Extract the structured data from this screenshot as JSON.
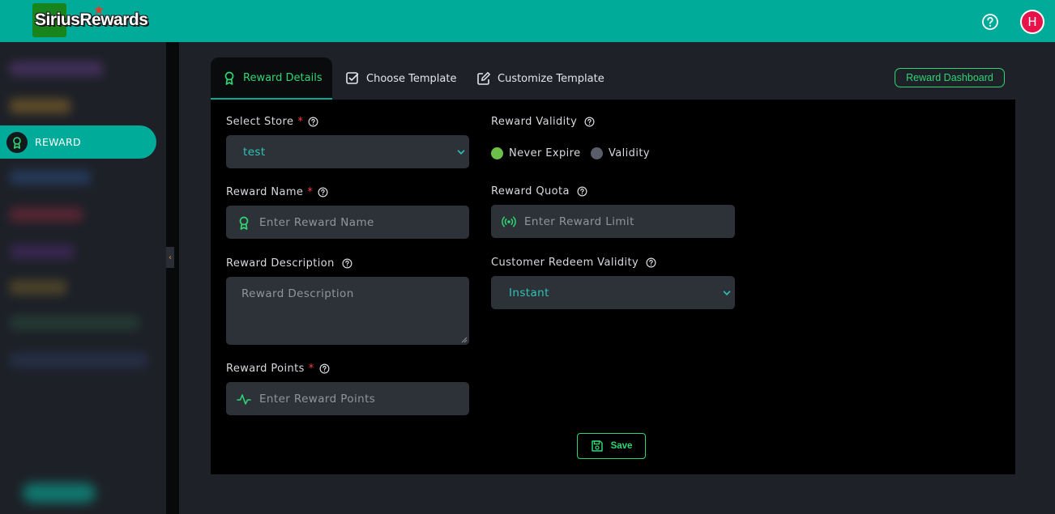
{
  "header": {
    "logo_text": "SiriusRewards",
    "avatar_initial": "H",
    "colors": {
      "bar": "#00ab9a",
      "avatar": "#e8124a"
    }
  },
  "sidebar": {
    "active_item": {
      "label": "REWARD",
      "icon": "award-icon"
    }
  },
  "tabs": [
    {
      "label": "Reward Details",
      "icon": "award-icon",
      "active": true
    },
    {
      "label": "Choose Template",
      "icon": "checkbox-icon",
      "active": false
    },
    {
      "label": "Customize Template",
      "icon": "edit-icon",
      "active": false
    }
  ],
  "dashboard_button": "Reward Dashboard",
  "form": {
    "select_store": {
      "label": "Select Store",
      "value": "test"
    },
    "reward_name": {
      "label": "Reward Name",
      "placeholder": "Enter Reward  Name"
    },
    "reward_description": {
      "label": "Reward Description",
      "placeholder": "Reward  Description"
    },
    "reward_points": {
      "label": "Reward Points",
      "placeholder": "Enter Reward  Points"
    },
    "reward_validity": {
      "label": "Reward Validity",
      "options": [
        {
          "label": "Never Expire",
          "selected": true
        },
        {
          "label": "Validity",
          "selected": false
        }
      ]
    },
    "reward_quota": {
      "label": "Reward Quota",
      "placeholder": "Enter Reward Limit"
    },
    "customer_redeem_validity": {
      "label": "Customer Redeem Validity",
      "value": "Instant"
    },
    "required_mark": "*"
  },
  "save_label": "Save",
  "accent_color": "#2ed673"
}
